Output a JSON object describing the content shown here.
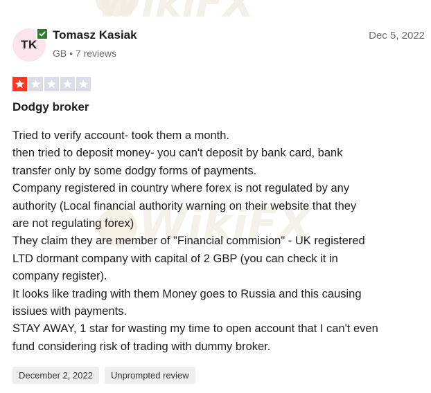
{
  "review": {
    "reviewer": {
      "initials": "TK",
      "name": "Tomasz Kasiak",
      "meta": "GB • 7 reviews",
      "verified_icon": "check-icon"
    },
    "date": "Dec 5, 2022",
    "rating": 1,
    "max_rating": 5,
    "title": "Dodgy broker",
    "body_lines": [
      "Tried to verify account- took them a month.",
      "then tried to deposit money- you can't deposit by bank card, bank",
      "transfer only by some dodgy forms of payments.",
      "Company registered in country where forex is not regulated by any",
      "authority (Local financial authority warning on their website that they",
      "are not regulating forex)",
      "They claim they are member of \"Financial commision\" - UK registered",
      "LTD dormant company with capital of 2 GBP (you can check it in",
      "company register).",
      "It looks like trading with them Money goes to Russia and this causing",
      "issiues with payments.",
      "STAY AWAY, 1 star for wasting my time to open account that I can't even",
      "fund considering risk of trading with dummy broker."
    ],
    "chips": {
      "experience_date": "December 2, 2022",
      "review_type": "Unprompted review"
    }
  },
  "watermark": {
    "text": "WikiFX"
  },
  "colors": {
    "star_filled": "#ff3722",
    "star_empty": "#dcdce6",
    "avatar_bg": "#fce4ec",
    "verified_badge": "#2e7d32",
    "chip_bg": "#eeeeee"
  }
}
